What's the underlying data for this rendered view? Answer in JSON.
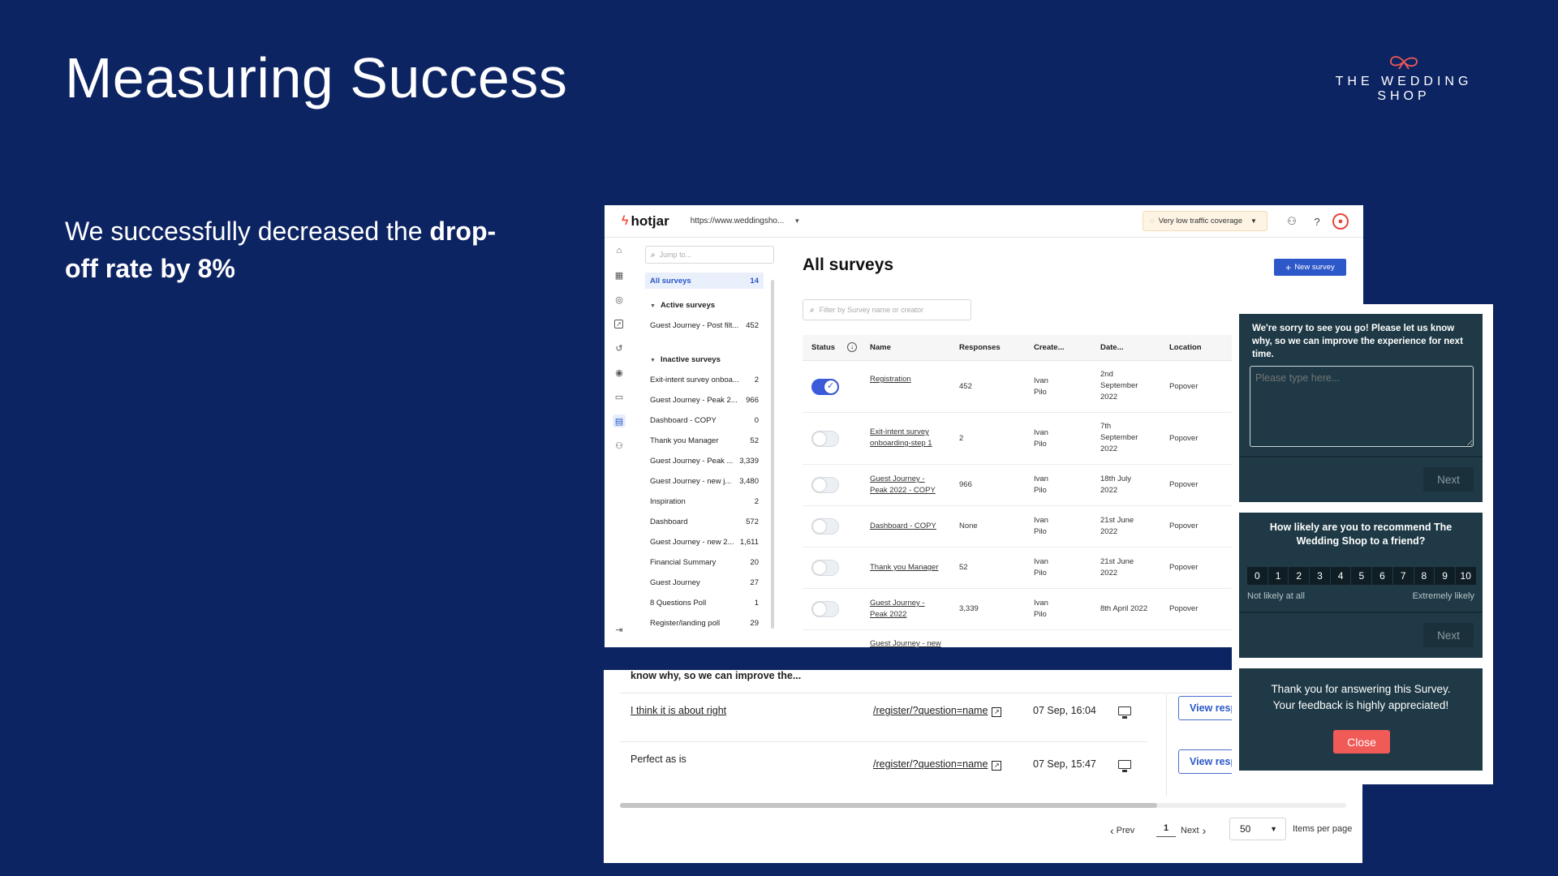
{
  "slide": {
    "title": "Measuring Success",
    "subtitle_plain": "We successfully decreased the ",
    "subtitle_bold": "drop-off rate by 8%",
    "brand_name": "THE WEDDING SHOP",
    "brand_color": "#f05a57"
  },
  "hotjar": {
    "logo": "hotjar",
    "url": "https://www.weddingsho...",
    "traffic": "Very low traffic coverage",
    "jump_placeholder": "Jump to...",
    "page_title": "All surveys",
    "new_survey": "New survey",
    "filter_placeholder": "Filter by Survey name or creator",
    "sidebar": {
      "all": {
        "label": "All surveys",
        "count": "14"
      },
      "active_head": "Active surveys",
      "active": [
        {
          "label": "Guest Journey - Post filt...",
          "count": "452"
        }
      ],
      "inactive_head": "Inactive surveys",
      "inactive": [
        {
          "label": "Exit-intent survey onboa...",
          "count": "2"
        },
        {
          "label": "Guest Journey - Peak 2...",
          "count": "966"
        },
        {
          "label": "Dashboard - COPY",
          "count": "0"
        },
        {
          "label": "Thank you Manager",
          "count": "52"
        },
        {
          "label": "Guest Journey - Peak ...",
          "count": "3,339"
        },
        {
          "label": "Guest Journey - new j...",
          "count": "3,480"
        },
        {
          "label": "Inspiration",
          "count": "2"
        },
        {
          "label": "Dashboard",
          "count": "572"
        },
        {
          "label": "Guest Journey - new 2...",
          "count": "1,611"
        },
        {
          "label": "Financial Summary",
          "count": "20"
        },
        {
          "label": "Guest Journey",
          "count": "27"
        },
        {
          "label": "8 Questions Poll",
          "count": "1"
        },
        {
          "label": "Register/landing poll",
          "count": "29"
        }
      ]
    },
    "columns": [
      "Status",
      "Name",
      "Responses",
      "Create...",
      "Date...",
      "Location"
    ],
    "rows": [
      {
        "on": true,
        "name1": "Registration",
        "name2": "",
        "responses": "452",
        "creator1": "Ivan",
        "creator2": "Pilo",
        "date1": "2nd",
        "date2": "September",
        "date3": "2022",
        "location": "Popover"
      },
      {
        "on": false,
        "name1": "Exit-intent survey",
        "name2": "onboarding-step 1",
        "responses": "2",
        "creator1": "Ivan",
        "creator2": "Pilo",
        "date1": "7th",
        "date2": "September",
        "date3": "2022",
        "location": "Popover"
      },
      {
        "on": false,
        "name1": "Guest Journey -",
        "name2": "Peak 2022 - COPY",
        "responses": "966",
        "creator1": "Ivan",
        "creator2": "Pilo",
        "date1": "18th July",
        "date2": "2022",
        "date3": "",
        "location": "Popover"
      },
      {
        "on": false,
        "name1": "Dashboard - COPY",
        "name2": "",
        "responses": "None",
        "creator1": "Ivan",
        "creator2": "Pilo",
        "date1": "21st June",
        "date2": "2022",
        "date3": "",
        "location": "Popover"
      },
      {
        "on": false,
        "name1": "Thank you Manager",
        "name2": "",
        "responses": "52",
        "creator1": "Ivan",
        "creator2": "Pilo",
        "date1": "21st June",
        "date2": "2022",
        "date3": "",
        "location": "Popover"
      },
      {
        "on": false,
        "name1": "Guest Journey -",
        "name2": "Peak 2022",
        "responses": "3,339",
        "creator1": "Ivan",
        "creator2": "Pilo",
        "date1": "8th April 2022",
        "date2": "",
        "date3": "",
        "location": "Popover"
      },
      {
        "on": false,
        "name1": "Guest Journey - new",
        "name2": "",
        "responses": "",
        "creator1": "",
        "creator2": "",
        "date1": "",
        "date2": "",
        "date3": "",
        "location": ""
      }
    ]
  },
  "responses": {
    "question": "know why, so we can improve the...",
    "rows": [
      {
        "answer": "I think it is about right",
        "url": "/register/?question=name",
        "date": "07 Sep, 16:04",
        "view": "View responses"
      },
      {
        "answer": "Perfect as is",
        "url": "/register/?question=name",
        "date": "07 Sep, 15:47",
        "view": "View responses"
      }
    ],
    "prev": "Prev",
    "page": "1",
    "next": "Next",
    "per_page": "50",
    "per_page_label": "Items per page"
  },
  "popovers": {
    "exit": {
      "message": "We're sorry to see you go! Please let us know why, so we can improve the experience for next time.",
      "placeholder": "Please type here...",
      "next": "Next"
    },
    "nps": {
      "question": "How likely are you to recommend The Wedding Shop to a friend?",
      "scale": [
        "0",
        "1",
        "2",
        "3",
        "4",
        "5",
        "6",
        "7",
        "8",
        "9",
        "10"
      ],
      "low": "Not likely at all",
      "high": "Extremely likely",
      "next": "Next"
    },
    "thanks": {
      "message1": "Thank you for answering this Survey.",
      "message2": "Your feedback is highly appreciated!",
      "close": "Close"
    }
  }
}
